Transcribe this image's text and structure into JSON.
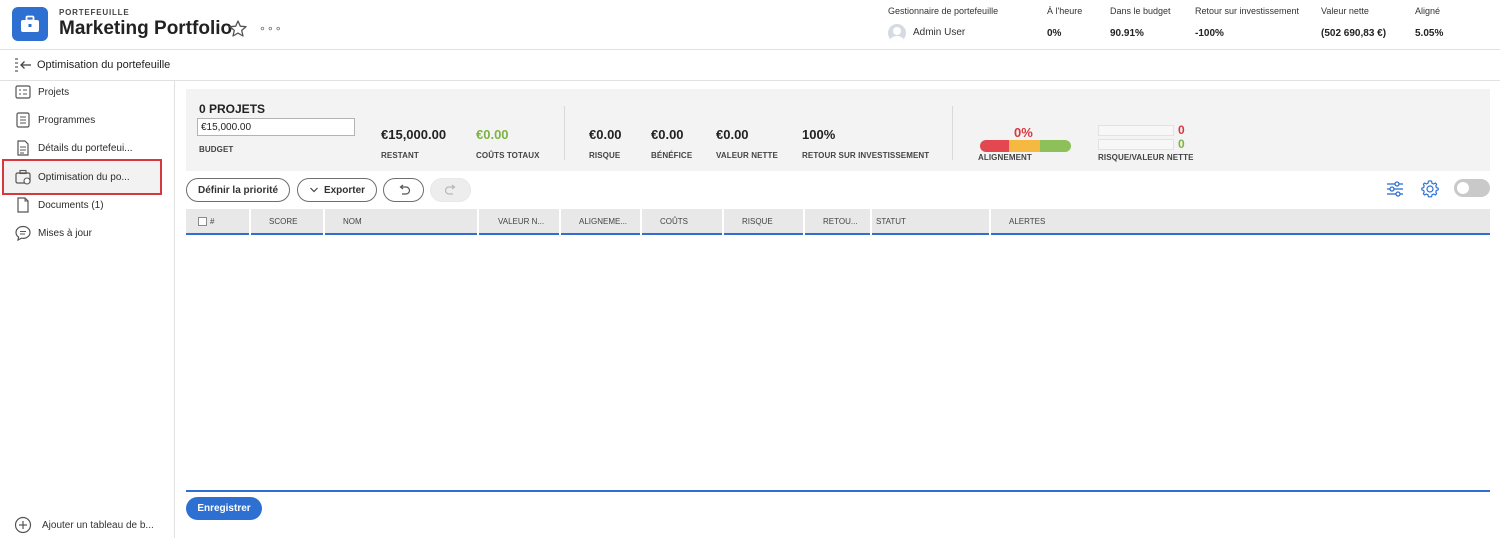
{
  "header": {
    "eyebrow": "PORTEFEUILLE",
    "title": "Marketing Portfolio",
    "metrics": [
      {
        "label": "Gestionnaire de portefeuille",
        "value": "Admin User"
      },
      {
        "label": "À l'heure",
        "value": "0%"
      },
      {
        "label": "Dans le budget",
        "value": "90.91%"
      },
      {
        "label": "Retour sur investissement",
        "value": "-100%"
      },
      {
        "label": "Valeur nette",
        "value": "(502 690,83 €)"
      },
      {
        "label": "Aligné",
        "value": "5.05%"
      }
    ]
  },
  "subbar": {
    "title": "Optimisation du portefeuille"
  },
  "sidebar": {
    "items": [
      {
        "label": "Projets",
        "icon": "projects-icon"
      },
      {
        "label": "Programmes",
        "icon": "programs-icon"
      },
      {
        "label": "Détails du portefeui...",
        "icon": "details-icon"
      },
      {
        "label": "Optimisation du po...",
        "icon": "optimization-icon",
        "active": true
      },
      {
        "label": "Documents (1)",
        "icon": "document-icon"
      },
      {
        "label": "Mises à jour",
        "icon": "updates-icon"
      }
    ],
    "add_board_label": "Ajouter un tableau de b..."
  },
  "summary": {
    "projects_count_label": "0 PROJETS",
    "budget_value": "€15,000.00",
    "budget_label": "BUDGET",
    "remaining_value": "€15,000.00",
    "remaining_label": "RESTANT",
    "total_costs_value": "€0.00",
    "total_costs_label": "COÛTS TOTAUX",
    "risk_value": "€0.00",
    "risk_label": "RISQUE",
    "profit_value": "€0.00",
    "profit_label": "BÉNÉFICE",
    "net_value_value": "€0.00",
    "net_value_label": "VALEUR NETTE",
    "roi_value": "100%",
    "roi_label": "RETOUR SUR INVESTISSEMENT",
    "alignment_value": "0%",
    "alignment_label": "ALIGNEMENT",
    "risk_netvalue_top": "0",
    "risk_netvalue_bottom": "0",
    "risk_netvalue_label": "RISQUE/VALEUR NETTE"
  },
  "toolbar": {
    "prioritize_label": "Définir la priorité",
    "export_label": "Exporter"
  },
  "table": {
    "columns": [
      "#",
      "SCORE",
      "NOM",
      "VALEUR N...",
      "ALIGNEME...",
      "COÛTS",
      "RISQUE",
      "RETOU...",
      "STATUT",
      "ALERTES"
    ]
  },
  "footer": {
    "save_label": "Enregistrer"
  },
  "colors": {
    "accent": "#2d70d2",
    "green": "#7cb342",
    "red": "#d7373f",
    "orange": "#f5b942",
    "align_red": "#e34850",
    "align_green": "#8ec05a"
  }
}
